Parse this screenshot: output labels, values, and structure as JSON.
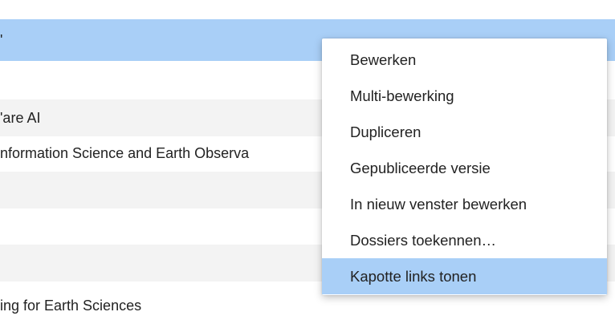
{
  "top_fragment": "",
  "table": {
    "header": "'",
    "rows": [
      {
        "text": "",
        "shaded": false
      },
      {
        "text": "'are AI",
        "shaded": true
      },
      {
        "text": "nformation Science and Earth Observa",
        "shaded": false
      },
      {
        "text": "",
        "shaded": true
      },
      {
        "text": "",
        "shaded": false
      },
      {
        "text": "",
        "shaded": true
      },
      {
        "text": "ing for Earth Sciences",
        "shaded": false
      }
    ]
  },
  "context_menu": {
    "items": [
      {
        "label": "Bewerken",
        "active": false
      },
      {
        "label": "Multi-bewerking",
        "active": false
      },
      {
        "label": "Dupliceren",
        "active": false
      },
      {
        "label": "Gepubliceerde versie",
        "active": false
      },
      {
        "label": "In nieuw venster bewerken",
        "active": false
      },
      {
        "label": "Dossiers toekennen…",
        "active": false
      },
      {
        "label": "Kapotte links tonen",
        "active": true
      }
    ]
  },
  "colors": {
    "selection": "#a9cff7",
    "row_shade": "#f3f3f3"
  }
}
